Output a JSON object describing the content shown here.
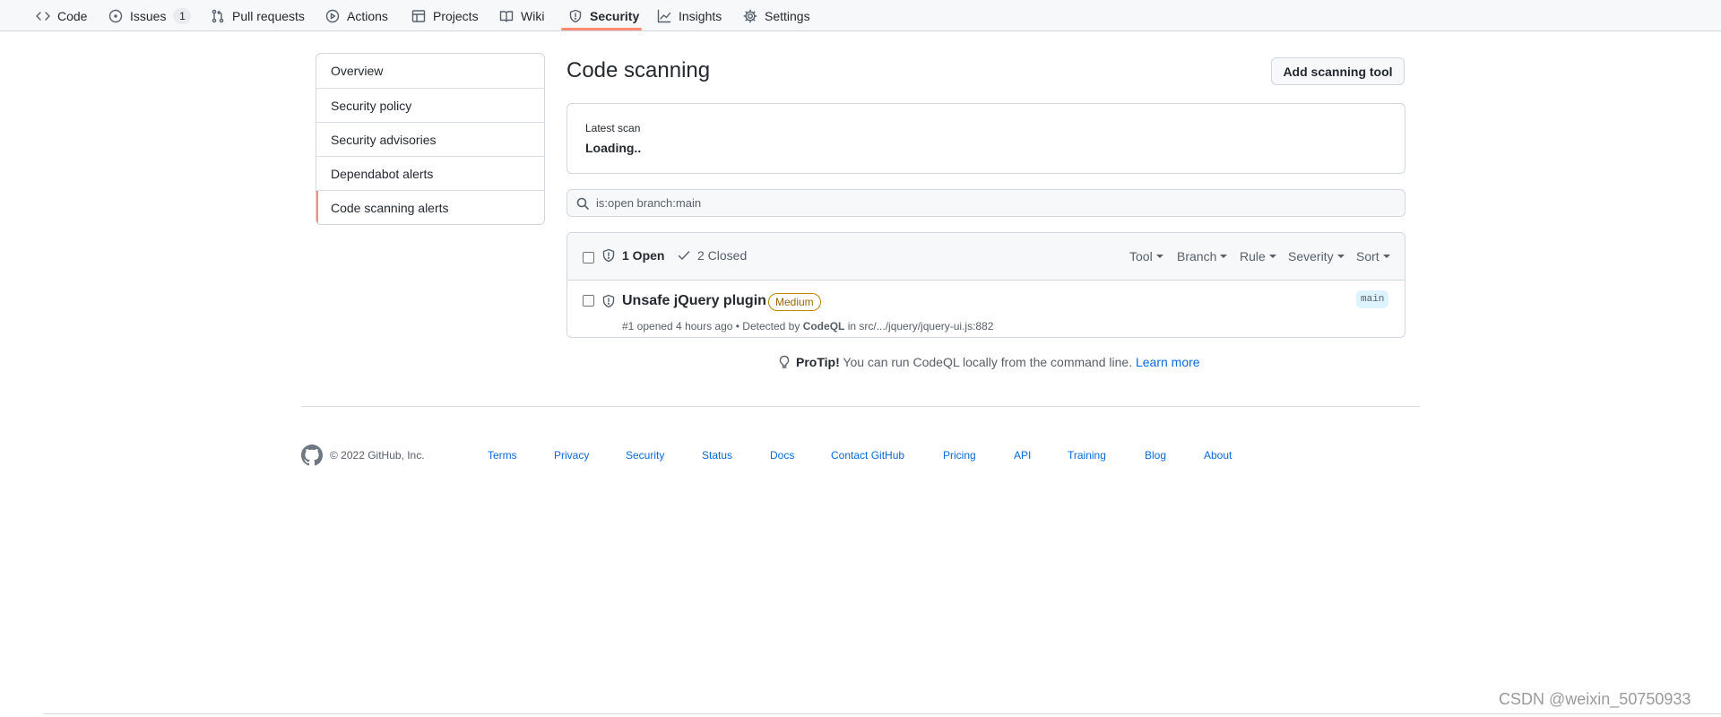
{
  "nav": {
    "tabs": [
      {
        "label": "Code",
        "icon": "code-icon"
      },
      {
        "label": "Issues",
        "icon": "issue-icon",
        "counter": "1"
      },
      {
        "label": "Pull requests",
        "icon": "pull-request-icon"
      },
      {
        "label": "Actions",
        "icon": "play-icon"
      },
      {
        "label": "Projects",
        "icon": "table-icon"
      },
      {
        "label": "Wiki",
        "icon": "book-icon"
      },
      {
        "label": "Security",
        "icon": "shield-icon",
        "selected": true
      },
      {
        "label": "Insights",
        "icon": "graph-icon"
      },
      {
        "label": "Settings",
        "icon": "gear-icon"
      }
    ],
    "selected_color": "#fd8c73"
  },
  "sidebar": {
    "items": [
      {
        "label": "Overview"
      },
      {
        "label": "Security policy"
      },
      {
        "label": "Security advisories"
      },
      {
        "label": "Dependabot alerts"
      },
      {
        "label": "Code scanning alerts",
        "selected": true
      }
    ]
  },
  "main": {
    "title": "Code scanning",
    "add_tool_label": "Add scanning tool",
    "latest_scan_label": "Latest scan",
    "latest_scan_value": "Loading..",
    "search_value": "is:open branch:main",
    "open_label": "1 Open",
    "closed_label": "2 Closed",
    "filters": [
      "Tool",
      "Branch",
      "Rule",
      "Severity",
      "Sort"
    ],
    "alert": {
      "title": "Unsafe jQuery plugin",
      "severity": "Medium",
      "meta_prefix": "#1 opened 4 hours ago • Detected by ",
      "tool": "CodeQL",
      "meta_suffix": " in src/.../jquery/jquery-ui.js:882",
      "branch": "main"
    },
    "protip": {
      "label": "ProTip!",
      "text": " You can run CodeQL locally from the command line. ",
      "link": "Learn more"
    }
  },
  "footer": {
    "copyright": "© 2022 GitHub, Inc.",
    "links": [
      "Terms",
      "Privacy",
      "Security",
      "Status",
      "Docs",
      "Contact GitHub",
      "Pricing",
      "API",
      "Training",
      "Blog",
      "About"
    ]
  },
  "watermark": "CSDN @weixin_50750933",
  "colors": {
    "accent": "#fd8c73",
    "link": "#0969da",
    "medium_border": "#bf8700"
  }
}
